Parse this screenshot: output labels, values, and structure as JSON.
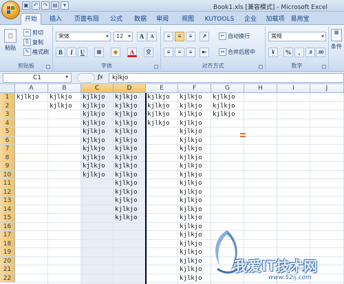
{
  "window": {
    "title": "Book1.xls [兼容模式] - Microsoft Excel"
  },
  "quick_access": [
    "save-icon",
    "undo-icon",
    "redo-icon",
    "print-preview-icon",
    "customize-icon"
  ],
  "tabs": [
    {
      "label": "开始",
      "active": true
    },
    {
      "label": "插入"
    },
    {
      "label": "页面布局"
    },
    {
      "label": "公式"
    },
    {
      "label": "数据"
    },
    {
      "label": "审阅"
    },
    {
      "label": "视图"
    },
    {
      "label": "KUTOOLS"
    },
    {
      "label": "企业"
    },
    {
      "label": "加载项"
    },
    {
      "label": "易用宝"
    }
  ],
  "ribbon": {
    "clipboard": {
      "paste": "粘贴",
      "cut": "剪切",
      "copy": "复制",
      "format_painter": "格式刷",
      "label": "剪贴板"
    },
    "font": {
      "name": "宋体",
      "size": "12",
      "grow": "A",
      "shrink": "A",
      "bold": "B",
      "italic": "I",
      "underline": "U",
      "strike": "变",
      "label": "字体"
    },
    "alignment": {
      "wrap": "自动换行",
      "merge": "合并后居中",
      "label": "对齐方式"
    },
    "number": {
      "format": "常规",
      "percent": "%",
      "comma": ",",
      "label": "数字"
    },
    "styles": {
      "conditional": "条件"
    }
  },
  "formula_bar": {
    "name_box": "C1",
    "fx": "fx",
    "value": "kjlkjo"
  },
  "grid": {
    "columns": [
      "A",
      "B",
      "C",
      "D",
      "E",
      "F",
      "G",
      "H",
      "I",
      "J"
    ],
    "rows": [
      "1",
      "2",
      "3",
      "4",
      "5",
      "6",
      "7",
      "8",
      "9",
      "10",
      "11",
      "12",
      "13",
      "14",
      "15",
      "16",
      "17",
      "18",
      "19",
      "20",
      "21",
      "22"
    ],
    "cell_text": "kjlkjo",
    "filled_row_counts": {
      "A": 1,
      "B": 2,
      "C": 10,
      "D": 15,
      "E": 4,
      "F": 22,
      "G": 3
    }
  },
  "watermark": {
    "text": "我爱IT技术网",
    "url": "www.52ij.com"
  },
  "colors": {
    "selection_header": "#f1c15f",
    "selected_column": "#e8eef8",
    "accent": "#15428b"
  }
}
